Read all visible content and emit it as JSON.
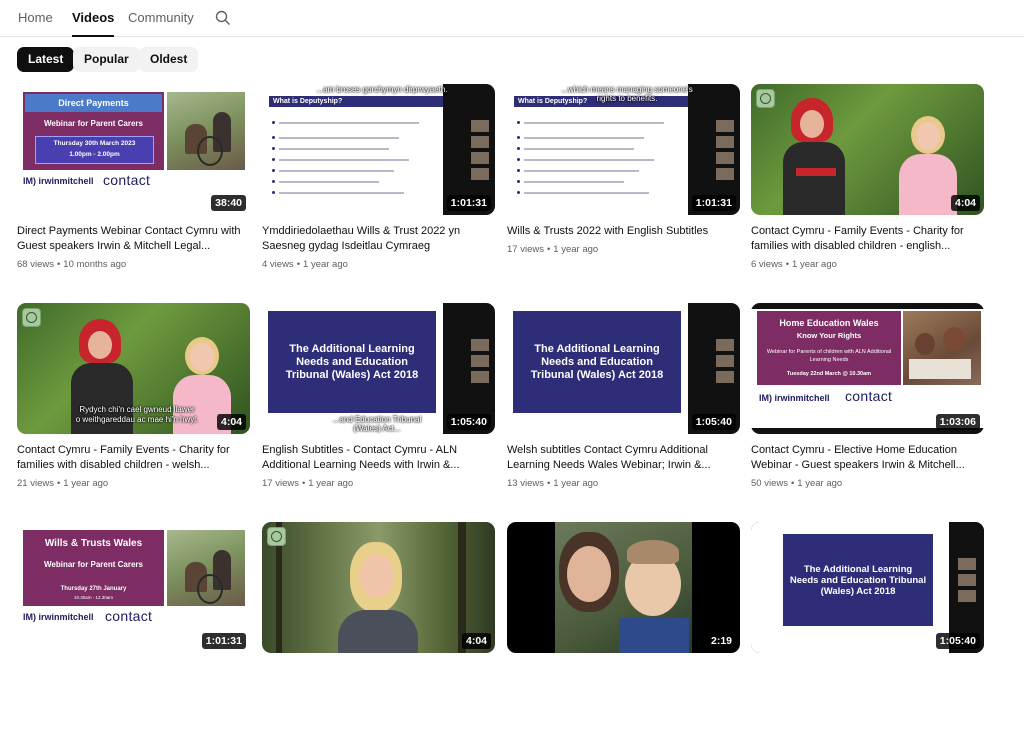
{
  "nav": {
    "tabs": [
      {
        "label": "Home",
        "active": false
      },
      {
        "label": "Videos",
        "active": true
      },
      {
        "label": "Community",
        "active": false
      }
    ],
    "search_icon": "search-icon"
  },
  "filters": [
    {
      "label": "Latest",
      "active": true
    },
    {
      "label": "Popular",
      "active": false
    },
    {
      "label": "Oldest",
      "active": false
    }
  ],
  "colors": {
    "accent_dark": "#0f0f0f",
    "meta_gray": "#606060",
    "slide_navy": "#2e2d78",
    "banner_purple": "#7e2c64"
  },
  "thumbs": {
    "direct_payments": {
      "heading": "Direct Payments",
      "subheading": "Webinar for Parent Carers",
      "date_line1": "Thursday 30th March 2023",
      "date_line2": "1.00pm - 2.00pm",
      "logo_im": "IM) irwinmitchell",
      "logo_contact": "contact"
    },
    "deputyship_1": {
      "caption": "...am broses gorchymyn dirprwyaeth.",
      "slide_title": "What is Deputyship?"
    },
    "deputyship_2": {
      "caption_line1": "...which means managing someone's",
      "caption_line2": "rights to benefits.",
      "slide_title": "What is Deputyship?"
    },
    "welsh_family_caption": {
      "line1": "Rydych chi'n cael gwneud llawer",
      "line2": "o weithgareddau ac mae hi'n hwyl."
    },
    "aln_1": {
      "title": "The Additional Learning Needs and Education Tribunal (Wales) Act 2018",
      "caption_line1": "...and Education Tribunal",
      "caption_line2": "(Wales) Act..."
    },
    "aln_2": {
      "title": "The Additional Learning Needs and Education Tribunal (Wales) Act 2018"
    },
    "home_ed": {
      "heading": "Home Education Wales",
      "subheading": "Know Your Rights",
      "body": "Webinar for Parents of children with ALN Additional Learning Needs",
      "date": "Tuesday 22nd March @ 10.30am",
      "logo_im": "IM) irwinmitchell",
      "logo_contact": "contact"
    },
    "wills_wales": {
      "heading": "Wills & Trusts Wales",
      "subheading": "Webinar for Parent Carers",
      "date_line1": "Thursday 27th January",
      "date_line2": "10.30am - 12.30am",
      "logo_im": "IM) irwinmitchell",
      "logo_contact": "contact"
    },
    "aln_3": {
      "title": "The Additional Learning Needs and Education Tribunal (Wales) Act 2018"
    }
  },
  "videos": [
    {
      "title": "Direct Payments Webinar Contact Cymru with Guest speakers Irwin & Mitchell Legal...",
      "views": "68 views",
      "age": "10 months ago",
      "duration": "38:40"
    },
    {
      "title": "Ymddiriedolaethau Wills & Trust 2022 yn Saesneg gydag Isdeitlau Cymraeg",
      "views": "4 views",
      "age": "1 year ago",
      "duration": "1:01:31"
    },
    {
      "title": "Wills & Trusts 2022 with English Subtitles",
      "views": "17 views",
      "age": "1 year ago",
      "duration": "1:01:31"
    },
    {
      "title": "Contact Cymru - Family Events - Charity for families with disabled children - english...",
      "views": "6 views",
      "age": "1 year ago",
      "duration": "4:04"
    },
    {
      "title": "Contact Cymru - Family Events - Charity for families with disabled children - welsh...",
      "views": "21 views",
      "age": "1 year ago",
      "duration": "4:04"
    },
    {
      "title": "English Subtitles - Contact Cymru - ALN Additional Learning Needs with Irwin &...",
      "views": "17 views",
      "age": "1 year ago",
      "duration": "1:05:40"
    },
    {
      "title": "Welsh subtitles Contact Cymru Additional Learning Needs Wales Webinar; Irwin &...",
      "views": "13 views",
      "age": "1 year ago",
      "duration": "1:05:40"
    },
    {
      "title": "Contact Cymru - Elective Home Education Webinar - Guest speakers Irwin & Mitchell...",
      "views": "50 views",
      "age": "1 year ago",
      "duration": "1:03:06"
    },
    {
      "title": "",
      "views": "",
      "age": "",
      "duration": "1:01:31"
    },
    {
      "title": "",
      "views": "",
      "age": "",
      "duration": "4:04"
    },
    {
      "title": "",
      "views": "",
      "age": "",
      "duration": "2:19"
    },
    {
      "title": "",
      "views": "",
      "age": "",
      "duration": "1:05:40"
    }
  ]
}
